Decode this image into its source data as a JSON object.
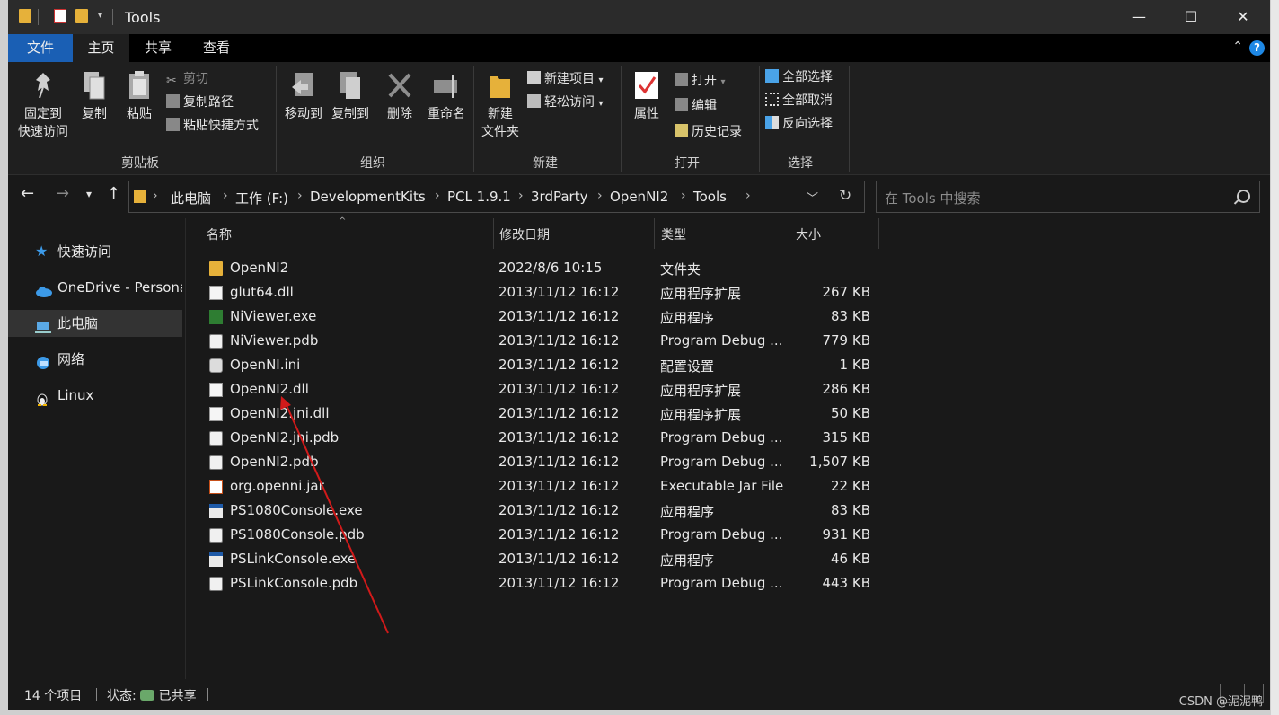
{
  "window": {
    "title": "Tools",
    "controls": {
      "minimize": "—",
      "maximize": "☐",
      "close": "✕"
    }
  },
  "tabs": {
    "file": "文件",
    "home": "主页",
    "share": "共享",
    "view": "查看",
    "help": "?"
  },
  "ribbon": {
    "clipboard": {
      "label": "剪贴板",
      "pin": "固定到\n快速访问",
      "pin_l1": "固定到",
      "pin_l2": "快速访问",
      "copy": "复制",
      "paste": "粘贴",
      "cut": "剪切",
      "copy_path": "复制路径",
      "paste_shortcut": "粘贴快捷方式"
    },
    "organize": {
      "label": "组织",
      "move_to": "移动到",
      "copy_to": "复制到",
      "delete": "删除",
      "rename": "重命名"
    },
    "new": {
      "label": "新建",
      "new_folder_l1": "新建",
      "new_folder_l2": "文件夹",
      "new_item": "新建项目",
      "easy_access": "轻松访问"
    },
    "open": {
      "label": "打开",
      "properties": "属性",
      "open": "打开",
      "edit": "编辑",
      "history": "历史记录"
    },
    "select": {
      "label": "选择",
      "select_all": "全部选择",
      "select_none": "全部取消",
      "invert": "反向选择"
    }
  },
  "address": {
    "crumbs": [
      "此电脑",
      "工作 (F:)",
      "DevelopmentKits",
      "PCL 1.9.1",
      "3rdParty",
      "OpenNI2",
      "Tools"
    ],
    "search_placeholder": "在 Tools 中搜索"
  },
  "nav": {
    "items": [
      {
        "label": "快速访问",
        "icon": "star-icon"
      },
      {
        "label": "OneDrive - Persona",
        "icon": "cloud-icon"
      },
      {
        "label": "此电脑",
        "icon": "computer-icon"
      },
      {
        "label": "网络",
        "icon": "network-icon"
      },
      {
        "label": "Linux",
        "icon": "penguin-icon"
      }
    ]
  },
  "columns": {
    "name": "名称",
    "date": "修改日期",
    "type": "类型",
    "size": "大小"
  },
  "files": [
    {
      "name": "OpenNI2",
      "date": "2022/8/6 10:15",
      "type": "文件夹",
      "size": "",
      "icon": "folder-icon"
    },
    {
      "name": "glut64.dll",
      "date": "2013/11/12 16:12",
      "type": "应用程序扩展",
      "size": "267 KB",
      "icon": "dll-icon"
    },
    {
      "name": "NiViewer.exe",
      "date": "2013/11/12 16:12",
      "type": "应用程序",
      "size": "83 KB",
      "icon": "niviewer-icon"
    },
    {
      "name": "NiViewer.pdb",
      "date": "2013/11/12 16:12",
      "type": "Program Debug ...",
      "size": "779 KB",
      "icon": "pdb-icon"
    },
    {
      "name": "OpenNI.ini",
      "date": "2013/11/12 16:12",
      "type": "配置设置",
      "size": "1 KB",
      "icon": "ini-icon"
    },
    {
      "name": "OpenNI2.dll",
      "date": "2013/11/12 16:12",
      "type": "应用程序扩展",
      "size": "286 KB",
      "icon": "dll-icon"
    },
    {
      "name": "OpenNI2.jni.dll",
      "date": "2013/11/12 16:12",
      "type": "应用程序扩展",
      "size": "50 KB",
      "icon": "dll-icon"
    },
    {
      "name": "OpenNI2.jni.pdb",
      "date": "2013/11/12 16:12",
      "type": "Program Debug ...",
      "size": "315 KB",
      "icon": "pdb-icon"
    },
    {
      "name": "OpenNI2.pdb",
      "date": "2013/11/12 16:12",
      "type": "Program Debug ...",
      "size": "1,507 KB",
      "icon": "pdb-icon"
    },
    {
      "name": "org.openni.jar",
      "date": "2013/11/12 16:12",
      "type": "Executable Jar File",
      "size": "22 KB",
      "icon": "jar-icon"
    },
    {
      "name": "PS1080Console.exe",
      "date": "2013/11/12 16:12",
      "type": "应用程序",
      "size": "83 KB",
      "icon": "exe-icon"
    },
    {
      "name": "PS1080Console.pdb",
      "date": "2013/11/12 16:12",
      "type": "Program Debug ...",
      "size": "931 KB",
      "icon": "pdb-icon"
    },
    {
      "name": "PSLinkConsole.exe",
      "date": "2013/11/12 16:12",
      "type": "应用程序",
      "size": "46 KB",
      "icon": "exe-icon"
    },
    {
      "name": "PSLinkConsole.pdb",
      "date": "2013/11/12 16:12",
      "type": "Program Debug ...",
      "size": "443 KB",
      "icon": "pdb-icon"
    }
  ],
  "status": {
    "count": "14 个项目",
    "state_label": "状态:",
    "state_value": "已共享"
  },
  "watermark": "CSDN @泥泥鸭",
  "annotation": {
    "color": "#d11a1a"
  }
}
